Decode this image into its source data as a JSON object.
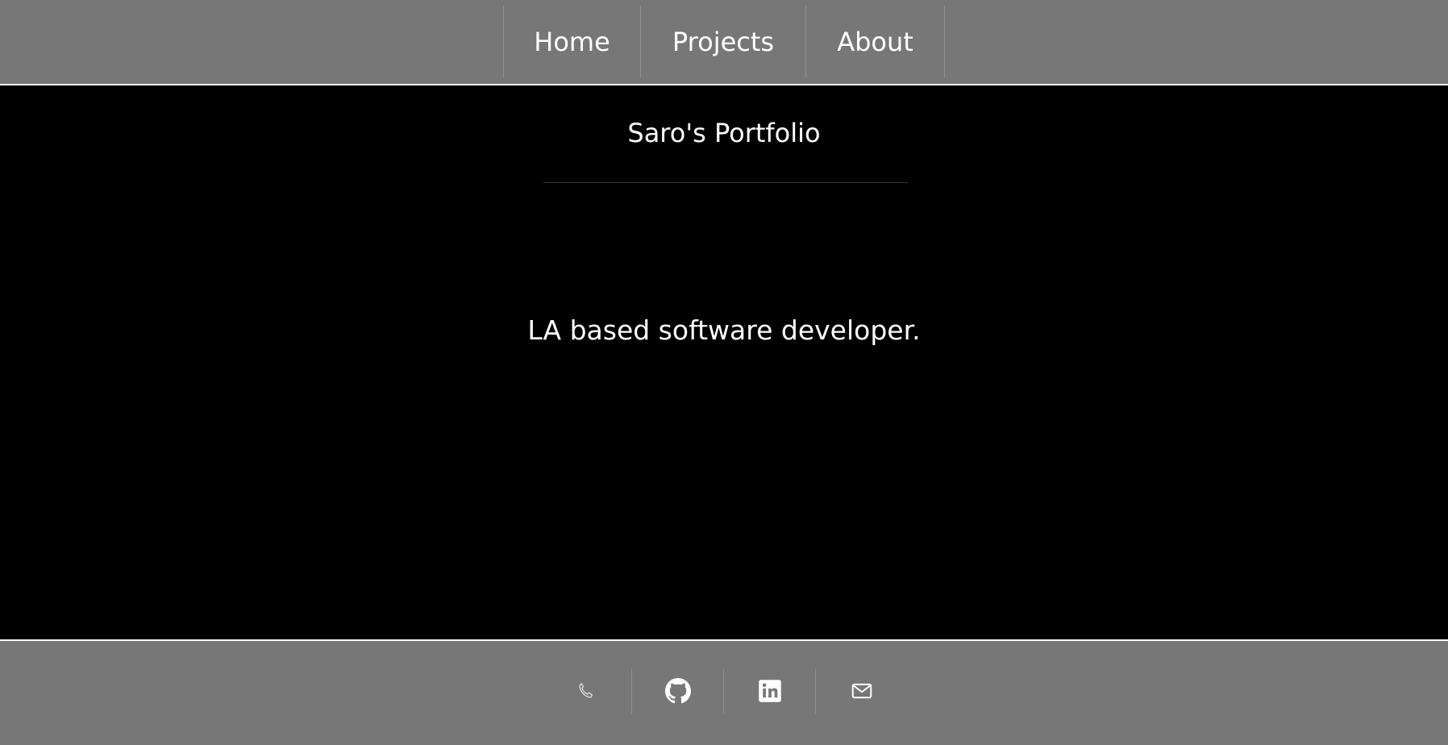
{
  "nav": {
    "items": [
      {
        "label": "Home"
      },
      {
        "label": "Projects"
      },
      {
        "label": "About"
      }
    ]
  },
  "main": {
    "title": "Saro's Portfolio",
    "tagline": "LA based software developer."
  },
  "footer": {
    "icons": [
      "phone-icon",
      "github-icon",
      "linkedin-icon",
      "mail-icon"
    ]
  },
  "colors": {
    "bar_background": "#777777",
    "main_background": "#000000",
    "text": "#ffffff"
  }
}
